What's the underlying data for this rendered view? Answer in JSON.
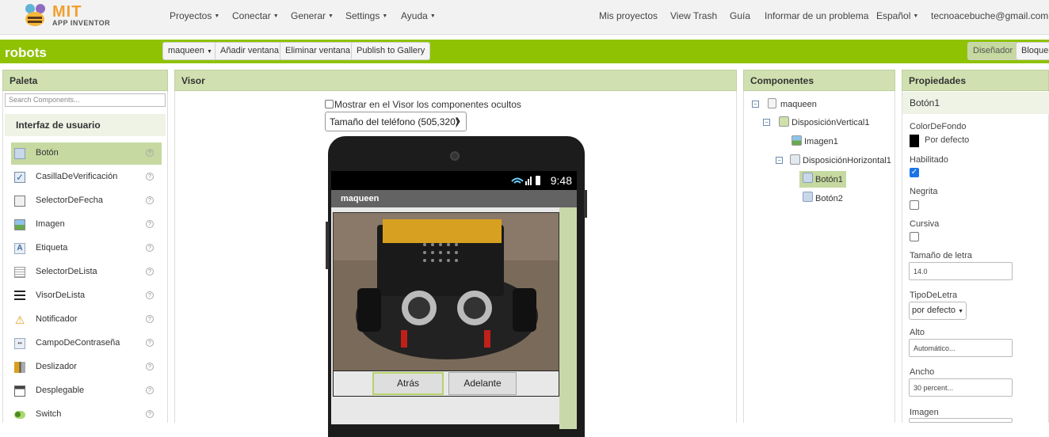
{
  "logo": {
    "mit": "MIT",
    "sub": "APP INVENTOR"
  },
  "topnav": {
    "left": [
      "Proyectos",
      "Conectar",
      "Generar",
      "Settings",
      "Ayuda"
    ],
    "right": [
      "Mis proyectos",
      "View Trash",
      "Guía",
      "Informar de un problema",
      "Español",
      "tecnoacebuche@gmail.com"
    ]
  },
  "project": {
    "name": "robots",
    "screen_selector": "maqueen",
    "buttons": [
      "Añadir ventana",
      "Eliminar ventana",
      "Publish to Gallery"
    ],
    "designer": "Diseñador",
    "blocks": "Bloques"
  },
  "palette": {
    "title": "Paleta",
    "search_placeholder": "Search Components...",
    "section": "Interfaz de usuario",
    "items": [
      {
        "label": "Botón",
        "icon": "button-icon"
      },
      {
        "label": "CasillaDeVerificación",
        "icon": "checkbox-icon"
      },
      {
        "label": "SelectorDeFecha",
        "icon": "calendar-icon"
      },
      {
        "label": "Imagen",
        "icon": "image-icon"
      },
      {
        "label": "Etiqueta",
        "icon": "label-icon"
      },
      {
        "label": "SelectorDeLista",
        "icon": "listpicker-icon"
      },
      {
        "label": "VisorDeLista",
        "icon": "listview-icon"
      },
      {
        "label": "Notificador",
        "icon": "warning-icon"
      },
      {
        "label": "CampoDeContraseña",
        "icon": "password-icon"
      },
      {
        "label": "Deslizador",
        "icon": "slider-icon"
      },
      {
        "label": "Desplegable",
        "icon": "spinner-icon"
      },
      {
        "label": "Switch",
        "icon": "switch-icon"
      }
    ]
  },
  "viewer": {
    "title": "Visor",
    "hidden_check": "Mostrar en el Visor los componentes ocultos",
    "phone_size": "Tamaño del teléfono (505,320)",
    "status_time": "9:48",
    "app_title": "maqueen",
    "buttons": [
      "Atrás",
      "Adelante"
    ]
  },
  "components": {
    "title": "Componentes",
    "tree": [
      "maqueen",
      "DisposiciónVertical1",
      "Imagen1",
      "DisposiciónHorizontal1",
      "Botón1",
      "Botón2"
    ]
  },
  "properties": {
    "title": "Propiedades",
    "component": "Botón1",
    "background_label": "ColorDeFondo",
    "background_value": "Por defecto",
    "enabled_label": "Habilitado",
    "bold_label": "Negrita",
    "italic_label": "Cursiva",
    "fontsize_label": "Tamaño de letra",
    "fontsize_value": "14.0",
    "typeface_label": "TipoDeLetra",
    "typeface_value": "por defecto",
    "height_label": "Alto",
    "height_value": "Automático...",
    "width_label": "Ancho",
    "width_value": "30 percent...",
    "image_label": "Imagen"
  }
}
